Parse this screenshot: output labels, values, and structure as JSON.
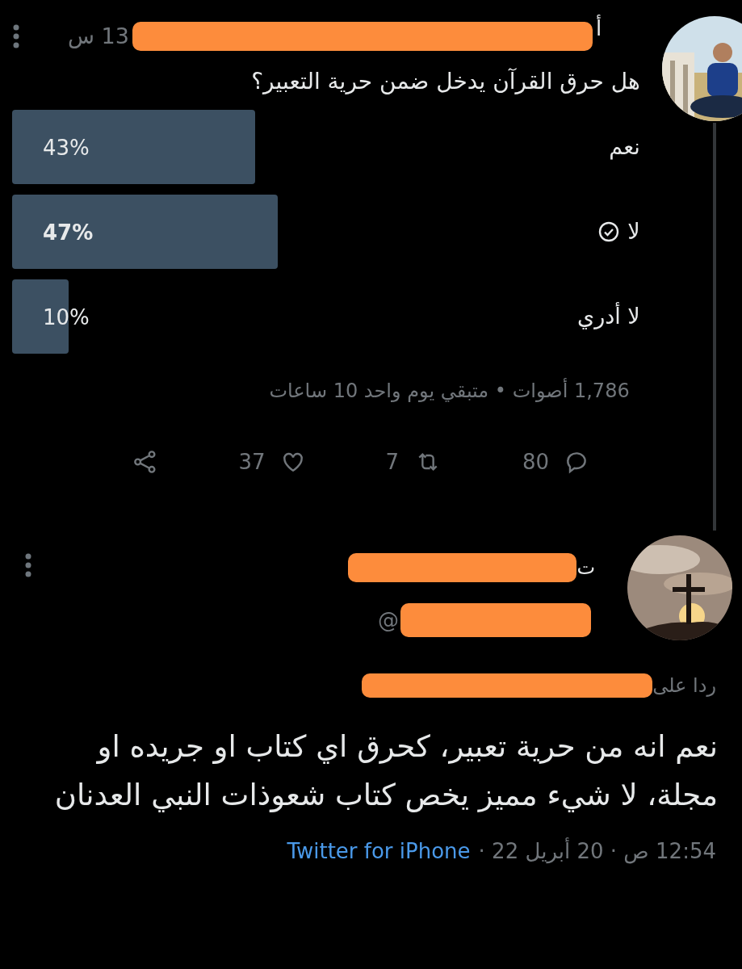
{
  "poll_tweet": {
    "author_fragment": "أ",
    "time": "13 س",
    "question": "هل حرق القرآن يدخل ضمن حرية التعبير؟",
    "options": [
      {
        "label": "نعم",
        "percent": "43%",
        "selected": false
      },
      {
        "label": "لا",
        "percent": "47%",
        "selected": true
      },
      {
        "label": "لا أدري",
        "percent": "10%",
        "selected": false
      }
    ],
    "meta": "1,786 أصوات • متبقي يوم واحد 10 ساعات",
    "actions": {
      "replies": "80",
      "retweets": "7",
      "likes": "37"
    }
  },
  "reply_tweet": {
    "name_fragment": "ت",
    "handle_fragment": "@",
    "reply_to": "ردا على",
    "body": "نعم انه من حرية تعبير، كحرق اي كتاب او جريده او مجلة، لا شيء مميز يخص كتاب شعوذات النبي العدنان",
    "timestamp": "12:54 ص · 20 أبريل 22 ·",
    "source": "Twitter for iPhone"
  }
}
